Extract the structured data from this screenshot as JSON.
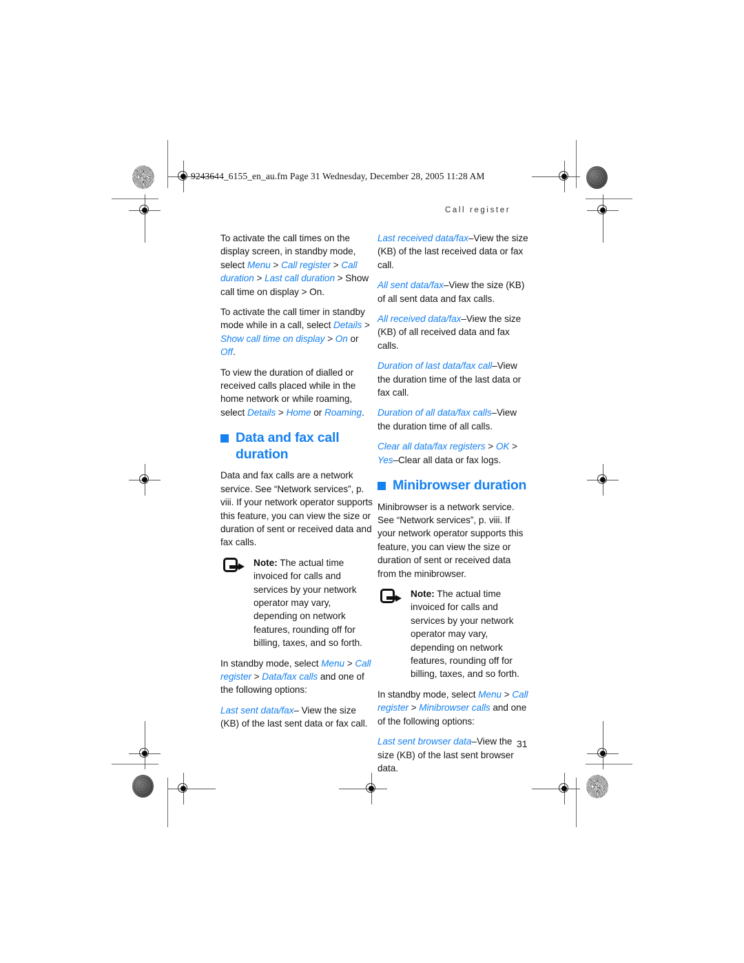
{
  "print_marks": {
    "slugline": "9243644_6155_en_au.fm  Page 31  Wednesday, December 28, 2005  11:28 AM",
    "running_head": "Call register",
    "folio": "31"
  },
  "colors": {
    "accent_blue": "#1580ef",
    "body_text": "#141414",
    "mark_gray": "#6a6a6a"
  },
  "left_column": {
    "para_1": {
      "t1": "To activate the call times on the display screen, in standby mode, select ",
      "ui1": "Menu",
      "s1": " > ",
      "ui2": "Call register",
      "s2": " > ",
      "ui3": "Call duration",
      "s3": " > ",
      "ui4": "Last call duration",
      "t2": " > Show call time on display > On."
    },
    "para_2": {
      "t1": "To activate the call timer in standby mode while in a call, select ",
      "ui1": "Details",
      "s1": " > ",
      "ui2": "Show call time on display",
      "s2": " > ",
      "ui3": "On",
      "t2": " or ",
      "ui4": "Off",
      "t3": "."
    },
    "para_3": {
      "t1": "To view the duration of dialled or received calls placed while in the home network or while roaming, select ",
      "ui1": "Details",
      "s1": " > ",
      "ui2": "Home",
      "t2": " or ",
      "ui3": "Roaming",
      "t3": "."
    },
    "heading": "Data and fax call duration",
    "para_4": "Data and fax calls are a network service. See “Network services”, p. viii. If your network operator supports this feature, you can view the size or duration of sent or received data and fax calls.",
    "note": {
      "label": "Note:",
      "text": " The actual time invoiced for calls and services by your network operator may vary, depending on network features, rounding off for billing, taxes, and so forth."
    },
    "para_5": {
      "t1": "In standby mode, select ",
      "ui1": "Menu",
      "s1": " > ",
      "ui2": "Call register",
      "s2": " > ",
      "ui3": "Data/fax calls",
      "t2": " and one of the following options:"
    },
    "para_6": {
      "ui1": "Last sent data/fax",
      "t1": "– View the size (KB) of the last sent data or fax call."
    }
  },
  "right_column": {
    "item_1": {
      "ui1": "Last received data/fax",
      "t1": "–View the size (KB) of the last received data or fax call."
    },
    "item_2": {
      "ui1": "All sent data/fax",
      "t1": "–View the size (KB) of all sent data and fax calls."
    },
    "item_3": {
      "ui1": "All received data/fax",
      "t1": "–View the size (KB) of all received data and fax calls."
    },
    "item_4": {
      "ui1": "Duration of last data/fax call",
      "t1": "–View the duration time of the last data or fax call."
    },
    "item_5": {
      "ui1": "Duration of all data/fax calls",
      "t1": "–View the duration time of all calls."
    },
    "item_6": {
      "ui1": "Clear all data/fax registers",
      "s1": " > ",
      "ui2": "OK",
      "s2": " > ",
      "ui3": "Yes",
      "t1": "–Clear all data or fax logs."
    },
    "heading": "Minibrowser duration",
    "para_1": "Minibrowser is a network service. See “Network services”, p. viii. If your network operator supports this feature, you can view the size or duration of sent or received data from the minibrowser.",
    "note": {
      "label": "Note:",
      "text": " The actual time invoiced for calls and services by your network operator may vary, depending on network features, rounding off for billing, taxes, and so forth."
    },
    "para_2": {
      "t1": "In standby mode, select ",
      "ui1": "Menu",
      "s1": " > ",
      "ui2": "Call register",
      "s2": " > ",
      "ui3": "Minibrowser calls",
      "t2": " and one of the following options:"
    },
    "item_7": {
      "ui1": "Last sent browser data",
      "t1": "–View the size (KB) of the last sent browser data."
    }
  }
}
